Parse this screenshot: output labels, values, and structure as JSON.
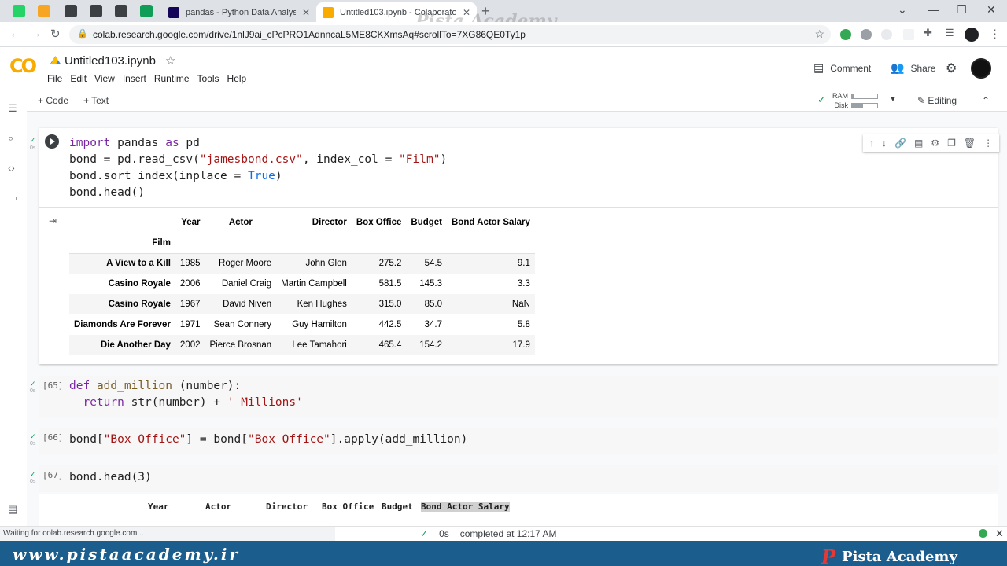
{
  "browser": {
    "tabs": [
      {
        "title": "pandas - Python Data Analysis Li",
        "favicon_color": "#150458"
      },
      {
        "title": "Untitled103.ipynb - Colaboratory",
        "favicon_color": "#f9ab00"
      }
    ],
    "pinned_colors": [
      "#25d366",
      "#f6a623",
      "#3c4043",
      "#3c4043",
      "#3c4043",
      "#0f9d58"
    ],
    "url": "colab.research.google.com/drive/1nlJ9ai_cPcPRO1AdnncaL5ME8CKXmsAq#scrollTo=7XG86QE0Ty1p",
    "tab_close": "✕",
    "new_tab": "+"
  },
  "watermark": {
    "top": "Pista Academy",
    "banner_left": "www.pistaacademy.ir",
    "banner_right": "Pista Academy"
  },
  "colab": {
    "logo": "CO",
    "doc_title": "Untitled103.ipynb",
    "menu": [
      "File",
      "Edit",
      "View",
      "Insert",
      "Runtime",
      "Tools",
      "Help"
    ],
    "comment_label": "Comment",
    "share_label": "Share",
    "add_code": "+ Code",
    "add_text": "+ Text",
    "ram_label": "RAM",
    "disk_label": "Disk",
    "ram_usage": 0.05,
    "disk_usage": 0.45,
    "editing_label": "Editing"
  },
  "cells": {
    "cell1": {
      "status": "✓",
      "time": "0s",
      "code_lines": [
        [
          {
            "t": "import",
            "c": "kw"
          },
          {
            "t": " pandas "
          },
          {
            "t": "as",
            "c": "kw"
          },
          {
            "t": " pd"
          }
        ],
        [
          {
            "t": "bond = pd.read_csv("
          },
          {
            "t": "\"jamesbond.csv\"",
            "c": "str"
          },
          {
            "t": ", index_col = "
          },
          {
            "t": "\"Film\"",
            "c": "str"
          },
          {
            "t": ")"
          }
        ],
        [
          {
            "t": "bond.sort_index(inplace = "
          },
          {
            "t": "True",
            "c": "bool"
          },
          {
            "t": ")"
          }
        ],
        [
          {
            "t": "bond.head()"
          }
        ]
      ]
    },
    "table": {
      "columns": [
        "Year",
        "Actor",
        "Director",
        "Box Office",
        "Budget",
        "Bond Actor Salary"
      ],
      "index_name": "Film",
      "rows": [
        {
          "film": "A View to a Kill",
          "values": [
            "1985",
            "Roger Moore",
            "John Glen",
            "275.2",
            "54.5",
            "9.1"
          ]
        },
        {
          "film": "Casino Royale",
          "values": [
            "2006",
            "Daniel Craig",
            "Martin Campbell",
            "581.5",
            "145.3",
            "3.3"
          ]
        },
        {
          "film": "Casino Royale",
          "values": [
            "1967",
            "David Niven",
            "Ken Hughes",
            "315.0",
            "85.0",
            "NaN"
          ]
        },
        {
          "film": "Diamonds Are Forever",
          "values": [
            "1971",
            "Sean Connery",
            "Guy Hamilton",
            "442.5",
            "34.7",
            "5.8"
          ]
        },
        {
          "film": "Die Another Day",
          "values": [
            "2002",
            "Pierce Brosnan",
            "Lee Tamahori",
            "465.4",
            "154.2",
            "17.9"
          ]
        }
      ]
    },
    "cell2": {
      "exec_count": "[65]",
      "status": "✓",
      "time": "0s",
      "code_lines": [
        [
          {
            "t": "def",
            "c": "kw"
          },
          {
            "t": " "
          },
          {
            "t": "add_million",
            "c": "fn"
          },
          {
            "t": " (number):"
          }
        ],
        [
          {
            "t": "  "
          },
          {
            "t": "return",
            "c": "kw"
          },
          {
            "t": " str(number) + "
          },
          {
            "t": "' Millions'",
            "c": "str"
          }
        ]
      ]
    },
    "cell3": {
      "exec_count": "[66]",
      "status": "✓",
      "time": "0s",
      "code_lines": [
        [
          {
            "t": "bond["
          },
          {
            "t": "\"Box Office\"",
            "c": "str"
          },
          {
            "t": "] = bond["
          },
          {
            "t": "\"Box Office\"",
            "c": "str"
          },
          {
            "t": "].apply(add_million)"
          }
        ]
      ]
    },
    "cell4": {
      "exec_count": "[67]",
      "status": "✓",
      "time": "0s",
      "code_lines": [
        [
          {
            "t": "bond.head(3)"
          }
        ]
      ],
      "output_columns": [
        "Year",
        "Actor",
        "Director",
        "Box Office",
        "Budget",
        "Bond Actor Salary"
      ]
    }
  },
  "statusbar": {
    "waiting": "Waiting for colab.research.google.com...",
    "check": "✓",
    "duration": "0s",
    "completed": "completed at 12:17 AM",
    "close": "✕"
  }
}
